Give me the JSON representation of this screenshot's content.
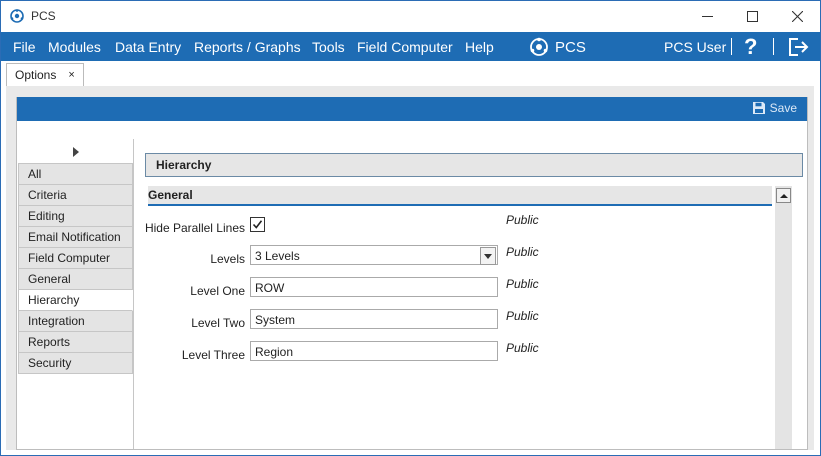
{
  "window": {
    "title": "PCS"
  },
  "menu": {
    "items": [
      "File",
      "Modules",
      "Data Entry",
      "Reports / Graphs",
      "Tools",
      "Field Computer",
      "Help"
    ],
    "brand": "PCS",
    "user": "PCS User",
    "help_glyph": "?"
  },
  "tabs": [
    {
      "label": "Options",
      "close_glyph": "×"
    }
  ],
  "toolbar": {
    "save_label": "Save"
  },
  "nav": {
    "items": [
      "All",
      "Criteria",
      "Editing",
      "Email Notification",
      "Field Computer",
      "General",
      "Hierarchy",
      "Integration",
      "Reports",
      "Security"
    ],
    "active": "Hierarchy"
  },
  "section": {
    "title": "Hierarchy",
    "group": "General"
  },
  "form": {
    "hide_parallel_lines": {
      "label": "Hide Parallel Lines",
      "checked": true,
      "scope": "Public"
    },
    "levels": {
      "label": "Levels",
      "value": "3 Levels",
      "scope": "Public"
    },
    "level_one": {
      "label": "Level One",
      "value": "ROW",
      "scope": "Public"
    },
    "level_two": {
      "label": "Level Two",
      "value": "System",
      "scope": "Public"
    },
    "level_three": {
      "label": "Level Three",
      "value": "Region",
      "scope": "Public"
    }
  },
  "icons": {
    "app": "pcs-logo-icon",
    "save": "floppy-disk-icon",
    "logout": "logout-icon",
    "help": "help-icon"
  },
  "colors": {
    "accent": "#1e6cb4"
  }
}
